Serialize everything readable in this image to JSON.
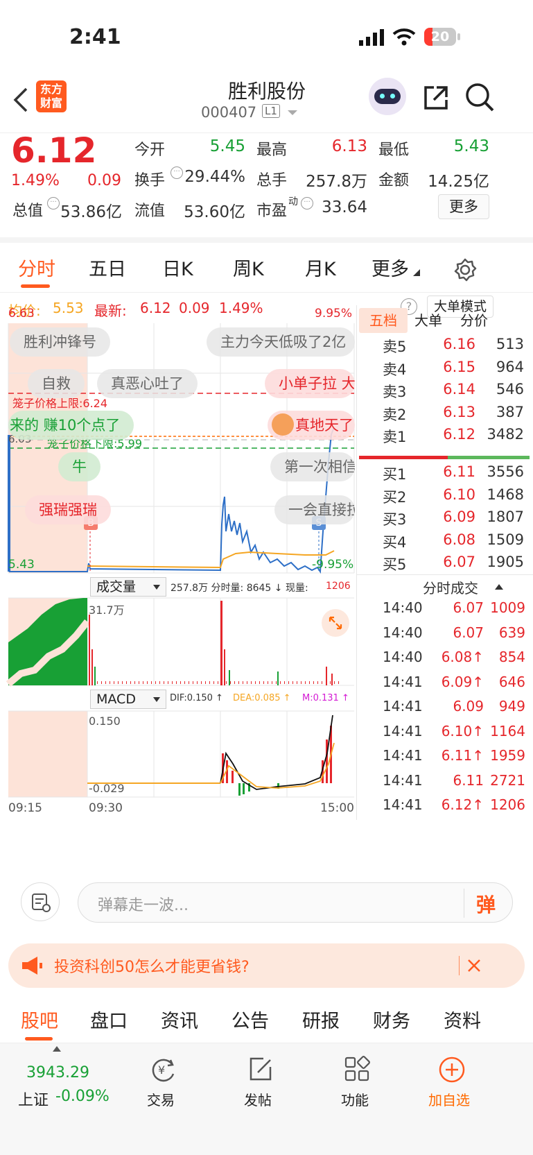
{
  "status": {
    "time": "2:41",
    "battery": "20"
  },
  "nav": {
    "logo_line1": "东方",
    "logo_line2": "财富",
    "title": "胜利股份",
    "code": "000407",
    "level": "L1"
  },
  "quote": {
    "price": "6.12",
    "pct": "1.49%",
    "chg": "0.09",
    "open_label": "今开",
    "open": "5.45",
    "high_label": "最高",
    "high": "6.13",
    "low_label": "最低",
    "low": "5.43",
    "turnover_label": "换手",
    "turnover": "29.44%",
    "volume_label": "总手",
    "volume": "257.8万",
    "amount_label": "金额",
    "amount": "14.25亿",
    "mcap_label": "总值",
    "mcap": "53.86亿",
    "float_label": "流值",
    "float": "53.60亿",
    "pe_label": "市盈",
    "pe_sup": "动",
    "pe": "33.64",
    "more": "更多"
  },
  "tabs": [
    "分时",
    "五日",
    "日K",
    "周K",
    "月K",
    "更多"
  ],
  "avgbar": {
    "avg_label": "均价:",
    "avg": "5.53",
    "last_label": "最新:",
    "last": "6.12",
    "chg": "0.09",
    "pct": "1.49%",
    "mode": "大单模式"
  },
  "chart": {
    "ymax": "6.63",
    "ymin": "5.43",
    "pmax": "9.95%",
    "pmin": "-9.95%",
    "prev_close": "6.03",
    "cage_up": "笼子价格上限:6.24",
    "cage_down": "笼子价格下限:5.99",
    "buy_tag": "B",
    "sell_tag": "S",
    "vol_select": "成交量",
    "vol_info": "257.8万 分时量: 8645 ↓ 现量:",
    "vol_now": "1206",
    "vol_max": "31.7万",
    "macd_select": "MACD",
    "dif": "DIF:0.150 ↑",
    "dea": "DEA:0.085 ↑",
    "m": "M:0.131 ↑",
    "macd_max": "0.150",
    "macd_min": "-0.029",
    "t_start": "09:15",
    "t_open": "09:30",
    "t_end": "15:00"
  },
  "bubbles": [
    "胜利冲锋号",
    "主力今天低吸了2亿",
    "自救",
    "真恶心吐了",
    "小单子拉 大",
    "来的 赚10个点了",
    "真地天了",
    "牛",
    "第一次相信",
    "强瑞强瑞",
    "一会直接拉"
  ],
  "book": {
    "tabs": [
      "五档",
      "大单",
      "分价"
    ],
    "asks": [
      {
        "l": "卖5",
        "p": "6.16",
        "v": "513"
      },
      {
        "l": "卖4",
        "p": "6.15",
        "v": "964"
      },
      {
        "l": "卖3",
        "p": "6.14",
        "v": "546"
      },
      {
        "l": "卖2",
        "p": "6.13",
        "v": "387"
      },
      {
        "l": "卖1",
        "p": "6.12",
        "v": "3482"
      }
    ],
    "bids": [
      {
        "l": "买1",
        "p": "6.11",
        "v": "3556"
      },
      {
        "l": "买2",
        "p": "6.10",
        "v": "1468"
      },
      {
        "l": "买3",
        "p": "6.09",
        "v": "1807"
      },
      {
        "l": "买4",
        "p": "6.08",
        "v": "1509"
      },
      {
        "l": "买5",
        "p": "6.07",
        "v": "1905"
      }
    ],
    "ticks_title": "分时成交",
    "ticks": [
      {
        "t": "14:40",
        "p": "6.07",
        "v": "1009"
      },
      {
        "t": "14:40",
        "p": "6.07",
        "v": "639"
      },
      {
        "t": "14:40",
        "p": "6.08↑",
        "v": "854"
      },
      {
        "t": "14:41",
        "p": "6.09↑",
        "v": "646"
      },
      {
        "t": "14:41",
        "p": "6.09",
        "v": "949"
      },
      {
        "t": "14:41",
        "p": "6.10↑",
        "v": "1164"
      },
      {
        "t": "14:41",
        "p": "6.11↑",
        "v": "1959"
      },
      {
        "t": "14:41",
        "p": "6.11",
        "v": "2721"
      },
      {
        "t": "14:41",
        "p": "6.12↑",
        "v": "1206"
      }
    ]
  },
  "danmu": {
    "placeholder": "弹幕走一波...",
    "btn": "弹"
  },
  "ad": {
    "text": "投资科创50怎么才能更省钱?"
  },
  "btabs": [
    "股吧",
    "盘口",
    "资讯",
    "公告",
    "研报",
    "财务",
    "资料"
  ],
  "bottom": {
    "index": "3943.29",
    "index_name": "上证",
    "index_pct": "-0.09%",
    "trade": "交易",
    "post": "发帖",
    "func": "功能",
    "add": "加自选"
  }
}
